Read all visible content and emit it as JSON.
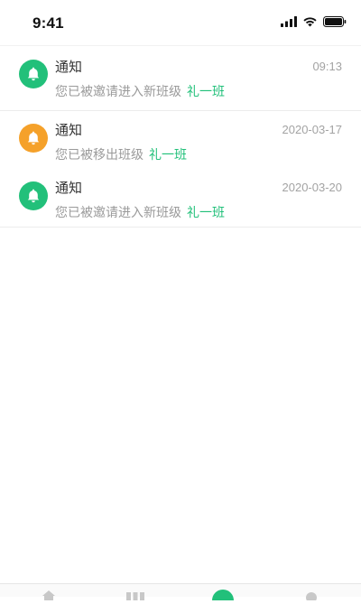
{
  "status_bar": {
    "time": "9:41",
    "icons": [
      "cellular-signal-icon",
      "wifi-icon",
      "battery-icon"
    ]
  },
  "colors": {
    "accent_green": "#22c07a",
    "bell_green": "#22c07a",
    "bell_orange": "#f5a12a",
    "muted_text": "#9a9a9a",
    "time_text": "#a3a3a3"
  },
  "notifications": [
    {
      "icon": "bell-icon",
      "icon_color": "#22c07a",
      "title": "通知",
      "time": "09:13",
      "message": "您已被邀请进入新班级",
      "class_name": "礼一班"
    },
    {
      "icon": "bell-icon",
      "icon_color": "#f5a12a",
      "title": "通知",
      "time": "2020-03-17",
      "message": "您已被移出班级",
      "class_name": "礼一班"
    },
    {
      "icon": "bell-icon",
      "icon_color": "#22c07a",
      "title": "通知",
      "time": "2020-03-20",
      "message": "您已被邀请进入新班级",
      "class_name": "礼一班"
    }
  ],
  "tabbar": {
    "tabs": [
      {
        "icon": "home-icon"
      },
      {
        "icon": "grid-icon"
      },
      {
        "icon": "message-icon",
        "active": true
      },
      {
        "icon": "profile-icon"
      }
    ]
  }
}
